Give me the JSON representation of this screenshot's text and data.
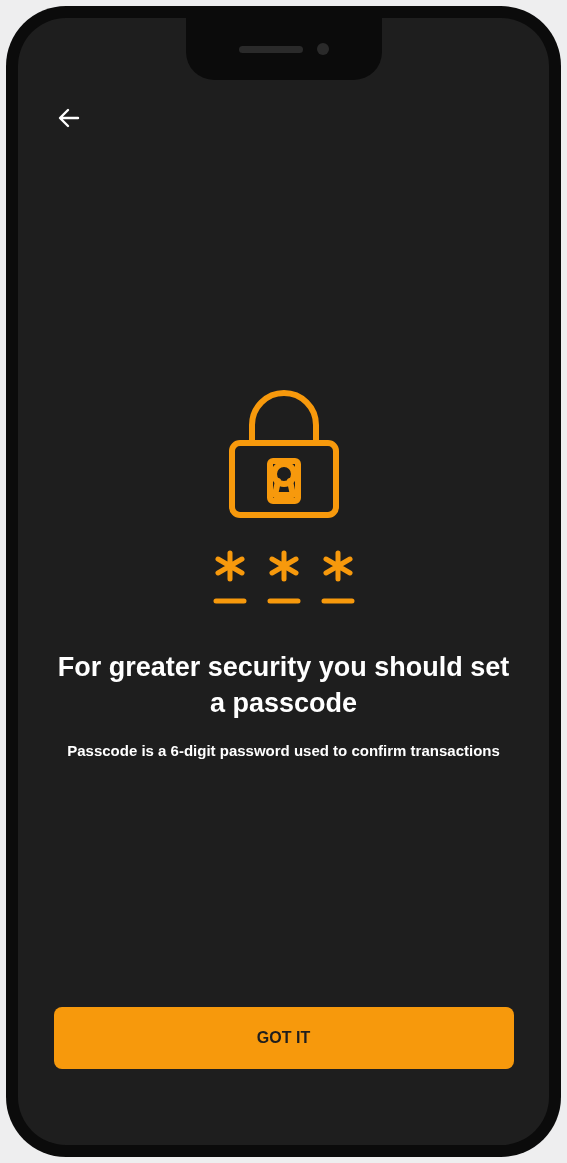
{
  "screen": {
    "title": "For greater security you should set a passcode",
    "description": "Passcode is a 6-digit password used to confirm transactions",
    "button": {
      "label": "GOT IT"
    }
  }
}
